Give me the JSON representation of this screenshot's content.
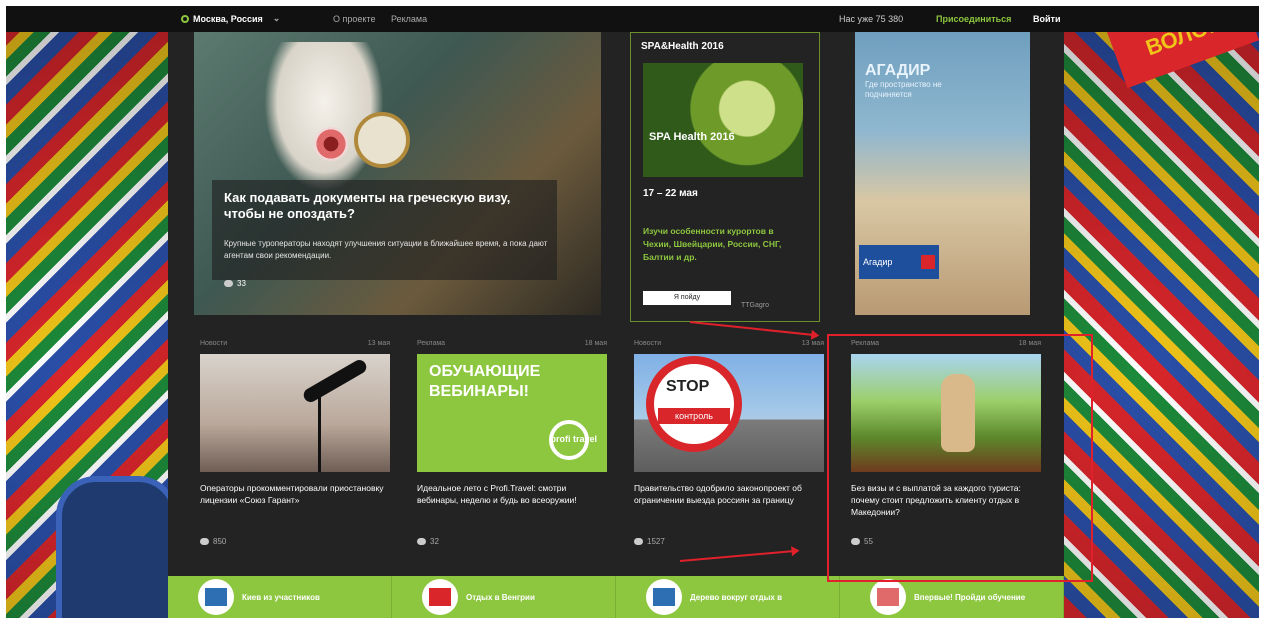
{
  "topbar": {
    "location": "Москва, Россия",
    "link1": "О проекте",
    "link2": "Реклама",
    "members": "Нас уже 75 380",
    "join": "Присоединиться",
    "login": "Войти"
  },
  "hero": {
    "title": "Как подавать документы на греческую визу, чтобы не опоздать?",
    "lead": "Крупные туроператоры находят улучшения ситуации в ближайшее время, а пока дают агентам свои рекомендации.",
    "comments": "33"
  },
  "spa": {
    "title": "SPA&Health 2016",
    "image_badge": "SPA Health 2016",
    "dates": "17 – 22 мая",
    "description": "Изучи особенности курортов в Чехии, Швейцарии, России, СНГ, Балтии и др.",
    "button": "Я пойду",
    "ad": "TTGagro"
  },
  "agadir": {
    "title": "АГАДИР",
    "subtitle": "Где пространство не подчиняется",
    "brand": "Агадир"
  },
  "cards": [
    {
      "category": "Новости",
      "date": "13 мая",
      "caption": "Операторы прокомментировали приостановку лицензии «Союз Гарант»",
      "views": "850"
    },
    {
      "category": "Реклама",
      "date": "18 мая",
      "image_title": "ОБУЧАЮЩИЕ ВЕБИНАРЫ!",
      "image_brand": "profi travel",
      "caption": "Идеальное лето с Profi.Travel: смотри вебинары, неделю и будь во всеоружии!",
      "views": "32"
    },
    {
      "category": "Новости",
      "date": "13 мая",
      "image_stop": "STOP",
      "image_control": "контроль",
      "caption": "Правительство одобрило законопроект об ограничении выезда россиян за границу",
      "views": "1527"
    },
    {
      "category": "Реклама",
      "date": "18 мая",
      "caption": "Без визы и с выплатой за каждого туриста: почему стоит предложить клиенту отдых в Македонии?",
      "views": "55"
    }
  ],
  "bottom": [
    "Киев из участников",
    "Отдых в Венгрии",
    "Дерево вокруг отдых в",
    "Впервые! Пройди обучение"
  ],
  "colors": {
    "accent": "#8dc63f",
    "annotation": "#e0202a",
    "background": "#232323"
  }
}
